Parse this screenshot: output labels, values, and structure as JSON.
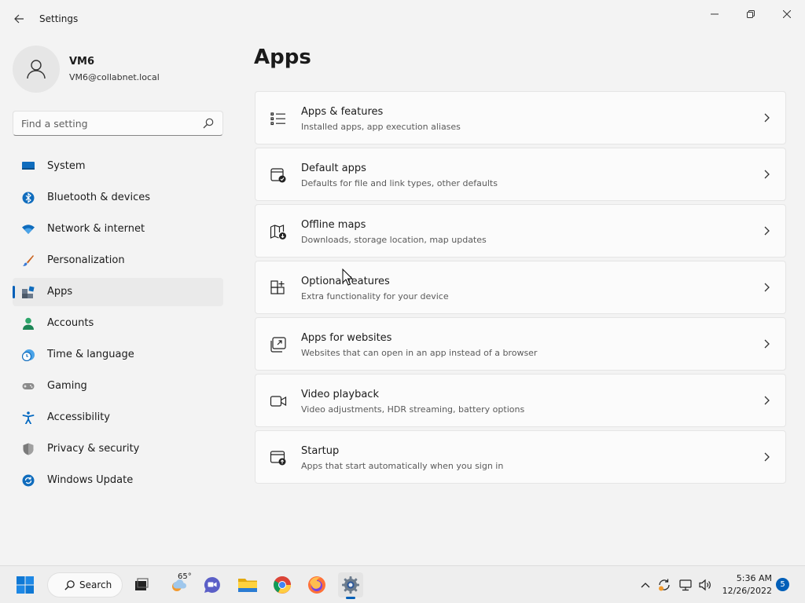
{
  "window": {
    "title": "Settings"
  },
  "user": {
    "name": "VM6",
    "email": "VM6@collabnet.local"
  },
  "search": {
    "placeholder": "Find a setting"
  },
  "nav": {
    "items": [
      {
        "label": "System",
        "icon": "system-icon",
        "color": "#0078d4"
      },
      {
        "label": "Bluetooth & devices",
        "icon": "bluetooth-icon",
        "color": "#0078d4"
      },
      {
        "label": "Network & internet",
        "icon": "wifi-icon",
        "color": "#0078d4"
      },
      {
        "label": "Personalization",
        "icon": "brush-icon",
        "color": "#e67e22"
      },
      {
        "label": "Apps",
        "icon": "apps-icon",
        "color": "#0078d4",
        "active": true
      },
      {
        "label": "Accounts",
        "icon": "person-icon",
        "color": "#2e9e6b"
      },
      {
        "label": "Time & language",
        "icon": "clock-globe-icon",
        "color": "#0078d4"
      },
      {
        "label": "Gaming",
        "icon": "gamepad-icon",
        "color": "#777777"
      },
      {
        "label": "Accessibility",
        "icon": "accessibility-icon",
        "color": "#0067c0"
      },
      {
        "label": "Privacy & security",
        "icon": "shield-icon",
        "color": "#6b6b6b"
      },
      {
        "label": "Windows Update",
        "icon": "update-icon",
        "color": "#0078d4"
      }
    ]
  },
  "page": {
    "title": "Apps"
  },
  "cards": [
    {
      "title": "Apps & features",
      "subtitle": "Installed apps, app execution aliases",
      "icon": "list-icon"
    },
    {
      "title": "Default apps",
      "subtitle": "Defaults for file and link types, other defaults",
      "icon": "default-apps-icon"
    },
    {
      "title": "Offline maps",
      "subtitle": "Downloads, storage location, map updates",
      "icon": "map-download-icon"
    },
    {
      "title": "Optional features",
      "subtitle": "Extra functionality for your device",
      "icon": "add-grid-icon"
    },
    {
      "title": "Apps for websites",
      "subtitle": "Websites that can open in an app instead of a browser",
      "icon": "open-external-icon"
    },
    {
      "title": "Video playback",
      "subtitle": "Video adjustments, HDR streaming, battery options",
      "icon": "video-camera-icon"
    },
    {
      "title": "Startup",
      "subtitle": "Apps that start automatically when you sign in",
      "icon": "startup-icon"
    }
  ],
  "taskbar": {
    "search_label": "Search",
    "weather_temp": "65°",
    "time": "5:36 AM",
    "date": "12/26/2022",
    "notification_count": "5"
  },
  "colors": {
    "accent": "#005fb8",
    "background": "#f3f3f3",
    "card": "#fbfbfb"
  }
}
